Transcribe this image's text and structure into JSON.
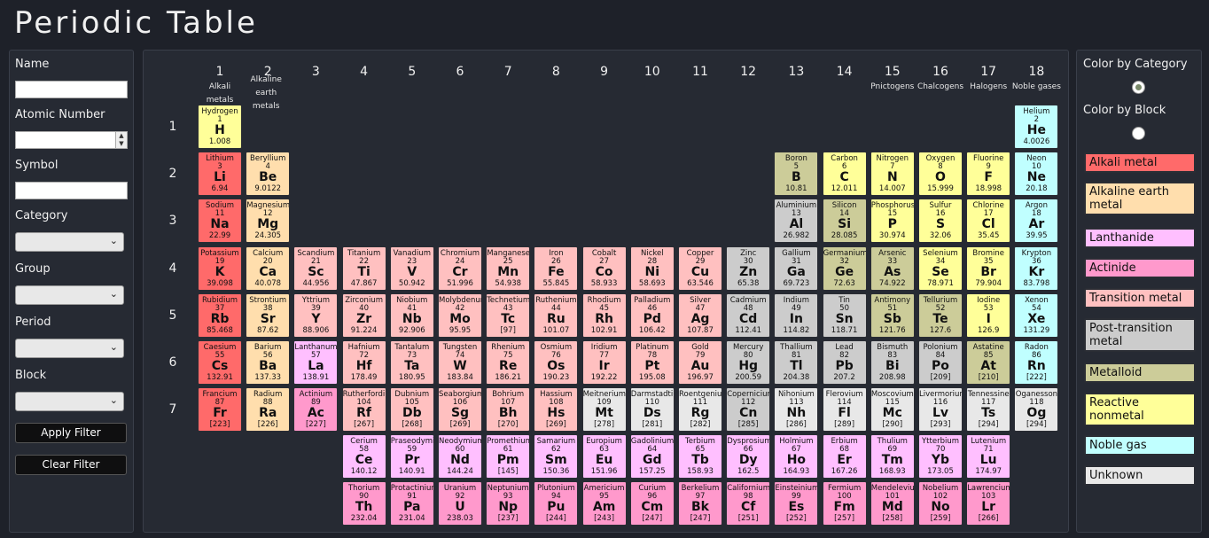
{
  "app": {
    "title": "Periodic Table"
  },
  "filters": {
    "name_label": "Name",
    "name_value": "",
    "atomic_number_label": "Atomic Number",
    "atomic_number_value": "",
    "symbol_label": "Symbol",
    "symbol_value": "",
    "category_label": "Category",
    "category_value": "",
    "group_label": "Group",
    "group_value": "",
    "period_label": "Period",
    "period_value": "",
    "block_label": "Block",
    "block_value": "",
    "apply_label": "Apply Filter",
    "clear_label": "Clear Filter"
  },
  "legend": {
    "by_category_label": "Color by Category",
    "by_block_label": "Color by Block",
    "selected": "category",
    "items": [
      {
        "label": "Alkali metal",
        "key": "alkali",
        "color": "#ff6a6a"
      },
      {
        "label": "Alkaline earth metal",
        "key": "alkaline",
        "color": "#ffdead"
      },
      {
        "label": "Lanthanide",
        "key": "lanthanide",
        "color": "#ffbfff"
      },
      {
        "label": "Actinide",
        "key": "actinide",
        "color": "#ff99cc"
      },
      {
        "label": "Transition metal",
        "key": "transition",
        "color": "#ffc0c0"
      },
      {
        "label": "Post-transition metal",
        "key": "post",
        "color": "#cccccc"
      },
      {
        "label": "Metalloid",
        "key": "metalloid",
        "color": "#cccc99"
      },
      {
        "label": "Reactive nonmetal",
        "key": "nonmetal",
        "color": "#ffff99"
      },
      {
        "label": "Noble gas",
        "key": "noble",
        "color": "#c0ffff"
      },
      {
        "label": "Unknown",
        "key": "unknown",
        "color": "#e8e8e8"
      }
    ]
  },
  "groups": [
    {
      "num": "1",
      "label": "Alkali metals"
    },
    {
      "num": "2",
      "label": "Alkaline earth metals"
    },
    {
      "num": "3",
      "label": ""
    },
    {
      "num": "4",
      "label": ""
    },
    {
      "num": "5",
      "label": ""
    },
    {
      "num": "6",
      "label": ""
    },
    {
      "num": "7",
      "label": ""
    },
    {
      "num": "8",
      "label": ""
    },
    {
      "num": "9",
      "label": ""
    },
    {
      "num": "10",
      "label": ""
    },
    {
      "num": "11",
      "label": ""
    },
    {
      "num": "12",
      "label": ""
    },
    {
      "num": "13",
      "label": ""
    },
    {
      "num": "14",
      "label": ""
    },
    {
      "num": "15",
      "label": "Pnictogens"
    },
    {
      "num": "16",
      "label": "Chalcogens"
    },
    {
      "num": "17",
      "label": "Halogens"
    },
    {
      "num": "18",
      "label": "Noble gases"
    }
  ],
  "periods": [
    "1",
    "2",
    "3",
    "4",
    "5",
    "6",
    "7"
  ],
  "elements": [
    {
      "n": "Hydrogen",
      "z": "1",
      "s": "H",
      "w": "1.008",
      "c": "nonmetal",
      "g": 1,
      "p": 1
    },
    {
      "n": "Helium",
      "z": "2",
      "s": "He",
      "w": "4.0026",
      "c": "noble",
      "g": 18,
      "p": 1
    },
    {
      "n": "Lithium",
      "z": "3",
      "s": "Li",
      "w": "6.94",
      "c": "alkali",
      "g": 1,
      "p": 2
    },
    {
      "n": "Beryllium",
      "z": "4",
      "s": "Be",
      "w": "9.0122",
      "c": "alkaline",
      "g": 2,
      "p": 2
    },
    {
      "n": "Boron",
      "z": "5",
      "s": "B",
      "w": "10.81",
      "c": "metalloid",
      "g": 13,
      "p": 2
    },
    {
      "n": "Carbon",
      "z": "6",
      "s": "C",
      "w": "12.011",
      "c": "nonmetal",
      "g": 14,
      "p": 2
    },
    {
      "n": "Nitrogen",
      "z": "7",
      "s": "N",
      "w": "14.007",
      "c": "nonmetal",
      "g": 15,
      "p": 2
    },
    {
      "n": "Oxygen",
      "z": "8",
      "s": "O",
      "w": "15.999",
      "c": "nonmetal",
      "g": 16,
      "p": 2
    },
    {
      "n": "Fluorine",
      "z": "9",
      "s": "F",
      "w": "18.998",
      "c": "nonmetal",
      "g": 17,
      "p": 2
    },
    {
      "n": "Neon",
      "z": "10",
      "s": "Ne",
      "w": "20.18",
      "c": "noble",
      "g": 18,
      "p": 2
    },
    {
      "n": "Sodium",
      "z": "11",
      "s": "Na",
      "w": "22.99",
      "c": "alkali",
      "g": 1,
      "p": 3
    },
    {
      "n": "Magnesium",
      "z": "12",
      "s": "Mg",
      "w": "24.305",
      "c": "alkaline",
      "g": 2,
      "p": 3
    },
    {
      "n": "Aluminium",
      "z": "13",
      "s": "Al",
      "w": "26.982",
      "c": "post",
      "g": 13,
      "p": 3
    },
    {
      "n": "Silicon",
      "z": "14",
      "s": "Si",
      "w": "28.085",
      "c": "metalloid",
      "g": 14,
      "p": 3
    },
    {
      "n": "Phosphorus",
      "z": "15",
      "s": "P",
      "w": "30.974",
      "c": "nonmetal",
      "g": 15,
      "p": 3
    },
    {
      "n": "Sulfur",
      "z": "16",
      "s": "S",
      "w": "32.06",
      "c": "nonmetal",
      "g": 16,
      "p": 3
    },
    {
      "n": "Chlorine",
      "z": "17",
      "s": "Cl",
      "w": "35.45",
      "c": "nonmetal",
      "g": 17,
      "p": 3
    },
    {
      "n": "Argon",
      "z": "18",
      "s": "Ar",
      "w": "39.95",
      "c": "noble",
      "g": 18,
      "p": 3
    },
    {
      "n": "Potassium",
      "z": "19",
      "s": "K",
      "w": "39.098",
      "c": "alkali",
      "g": 1,
      "p": 4
    },
    {
      "n": "Calcium",
      "z": "20",
      "s": "Ca",
      "w": "40.078",
      "c": "alkaline",
      "g": 2,
      "p": 4
    },
    {
      "n": "Scandium",
      "z": "21",
      "s": "Sc",
      "w": "44.956",
      "c": "transition",
      "g": 3,
      "p": 4
    },
    {
      "n": "Titanium",
      "z": "22",
      "s": "Ti",
      "w": "47.867",
      "c": "transition",
      "g": 4,
      "p": 4
    },
    {
      "n": "Vanadium",
      "z": "23",
      "s": "V",
      "w": "50.942",
      "c": "transition",
      "g": 5,
      "p": 4
    },
    {
      "n": "Chromium",
      "z": "24",
      "s": "Cr",
      "w": "51.996",
      "c": "transition",
      "g": 6,
      "p": 4
    },
    {
      "n": "Manganese",
      "z": "25",
      "s": "Mn",
      "w": "54.938",
      "c": "transition",
      "g": 7,
      "p": 4
    },
    {
      "n": "Iron",
      "z": "26",
      "s": "Fe",
      "w": "55.845",
      "c": "transition",
      "g": 8,
      "p": 4
    },
    {
      "n": "Cobalt",
      "z": "27",
      "s": "Co",
      "w": "58.933",
      "c": "transition",
      "g": 9,
      "p": 4
    },
    {
      "n": "Nickel",
      "z": "28",
      "s": "Ni",
      "w": "58.693",
      "c": "transition",
      "g": 10,
      "p": 4
    },
    {
      "n": "Copper",
      "z": "29",
      "s": "Cu",
      "w": "63.546",
      "c": "transition",
      "g": 11,
      "p": 4
    },
    {
      "n": "Zinc",
      "z": "30",
      "s": "Zn",
      "w": "65.38",
      "c": "post",
      "g": 12,
      "p": 4
    },
    {
      "n": "Gallium",
      "z": "31",
      "s": "Ga",
      "w": "69.723",
      "c": "post",
      "g": 13,
      "p": 4
    },
    {
      "n": "Germanium",
      "z": "32",
      "s": "Ge",
      "w": "72.63",
      "c": "metalloid",
      "g": 14,
      "p": 4
    },
    {
      "n": "Arsenic",
      "z": "33",
      "s": "As",
      "w": "74.922",
      "c": "metalloid",
      "g": 15,
      "p": 4
    },
    {
      "n": "Selenium",
      "z": "34",
      "s": "Se",
      "w": "78.971",
      "c": "nonmetal",
      "g": 16,
      "p": 4
    },
    {
      "n": "Bromine",
      "z": "35",
      "s": "Br",
      "w": "79.904",
      "c": "nonmetal",
      "g": 17,
      "p": 4
    },
    {
      "n": "Krypton",
      "z": "36",
      "s": "Kr",
      "w": "83.798",
      "c": "noble",
      "g": 18,
      "p": 4
    },
    {
      "n": "Rubidium",
      "z": "37",
      "s": "Rb",
      "w": "85.468",
      "c": "alkali",
      "g": 1,
      "p": 5
    },
    {
      "n": "Strontium",
      "z": "38",
      "s": "Sr",
      "w": "87.62",
      "c": "alkaline",
      "g": 2,
      "p": 5
    },
    {
      "n": "Yttrium",
      "z": "39",
      "s": "Y",
      "w": "88.906",
      "c": "transition",
      "g": 3,
      "p": 5
    },
    {
      "n": "Zirconium",
      "z": "40",
      "s": "Zr",
      "w": "91.224",
      "c": "transition",
      "g": 4,
      "p": 5
    },
    {
      "n": "Niobium",
      "z": "41",
      "s": "Nb",
      "w": "92.906",
      "c": "transition",
      "g": 5,
      "p": 5
    },
    {
      "n": "Molybdenum",
      "z": "42",
      "s": "Mo",
      "w": "95.95",
      "c": "transition",
      "g": 6,
      "p": 5
    },
    {
      "n": "Technetium",
      "z": "43",
      "s": "Tc",
      "w": "[97]",
      "c": "transition",
      "g": 7,
      "p": 5
    },
    {
      "n": "Ruthenium",
      "z": "44",
      "s": "Ru",
      "w": "101.07",
      "c": "transition",
      "g": 8,
      "p": 5
    },
    {
      "n": "Rhodium",
      "z": "45",
      "s": "Rh",
      "w": "102.91",
      "c": "transition",
      "g": 9,
      "p": 5
    },
    {
      "n": "Palladium",
      "z": "46",
      "s": "Pd",
      "w": "106.42",
      "c": "transition",
      "g": 10,
      "p": 5
    },
    {
      "n": "Silver",
      "z": "47",
      "s": "Ag",
      "w": "107.87",
      "c": "transition",
      "g": 11,
      "p": 5
    },
    {
      "n": "Cadmium",
      "z": "48",
      "s": "Cd",
      "w": "112.41",
      "c": "post",
      "g": 12,
      "p": 5
    },
    {
      "n": "Indium",
      "z": "49",
      "s": "In",
      "w": "114.82",
      "c": "post",
      "g": 13,
      "p": 5
    },
    {
      "n": "Tin",
      "z": "50",
      "s": "Sn",
      "w": "118.71",
      "c": "post",
      "g": 14,
      "p": 5
    },
    {
      "n": "Antimony",
      "z": "51",
      "s": "Sb",
      "w": "121.76",
      "c": "metalloid",
      "g": 15,
      "p": 5
    },
    {
      "n": "Tellurium",
      "z": "52",
      "s": "Te",
      "w": "127.6",
      "c": "metalloid",
      "g": 16,
      "p": 5
    },
    {
      "n": "Iodine",
      "z": "53",
      "s": "I",
      "w": "126.9",
      "c": "nonmetal",
      "g": 17,
      "p": 5
    },
    {
      "n": "Xenon",
      "z": "54",
      "s": "Xe",
      "w": "131.29",
      "c": "noble",
      "g": 18,
      "p": 5
    },
    {
      "n": "Caesium",
      "z": "55",
      "s": "Cs",
      "w": "132.91",
      "c": "alkali",
      "g": 1,
      "p": 6
    },
    {
      "n": "Barium",
      "z": "56",
      "s": "Ba",
      "w": "137.33",
      "c": "alkaline",
      "g": 2,
      "p": 6
    },
    {
      "n": "Lanthanum",
      "z": "57",
      "s": "La",
      "w": "138.91",
      "c": "lanthanide",
      "g": 3,
      "p": 6
    },
    {
      "n": "Hafnium",
      "z": "72",
      "s": "Hf",
      "w": "178.49",
      "c": "transition",
      "g": 4,
      "p": 6
    },
    {
      "n": "Tantalum",
      "z": "73",
      "s": "Ta",
      "w": "180.95",
      "c": "transition",
      "g": 5,
      "p": 6
    },
    {
      "n": "Tungsten",
      "z": "74",
      "s": "W",
      "w": "183.84",
      "c": "transition",
      "g": 6,
      "p": 6
    },
    {
      "n": "Rhenium",
      "z": "75",
      "s": "Re",
      "w": "186.21",
      "c": "transition",
      "g": 7,
      "p": 6
    },
    {
      "n": "Osmium",
      "z": "76",
      "s": "Os",
      "w": "190.23",
      "c": "transition",
      "g": 8,
      "p": 6
    },
    {
      "n": "Iridium",
      "z": "77",
      "s": "Ir",
      "w": "192.22",
      "c": "transition",
      "g": 9,
      "p": 6
    },
    {
      "n": "Platinum",
      "z": "78",
      "s": "Pt",
      "w": "195.08",
      "c": "transition",
      "g": 10,
      "p": 6
    },
    {
      "n": "Gold",
      "z": "79",
      "s": "Au",
      "w": "196.97",
      "c": "transition",
      "g": 11,
      "p": 6
    },
    {
      "n": "Mercury",
      "z": "80",
      "s": "Hg",
      "w": "200.59",
      "c": "post",
      "g": 12,
      "p": 6
    },
    {
      "n": "Thallium",
      "z": "81",
      "s": "Tl",
      "w": "204.38",
      "c": "post",
      "g": 13,
      "p": 6
    },
    {
      "n": "Lead",
      "z": "82",
      "s": "Pb",
      "w": "207.2",
      "c": "post",
      "g": 14,
      "p": 6
    },
    {
      "n": "Bismuth",
      "z": "83",
      "s": "Bi",
      "w": "208.98",
      "c": "post",
      "g": 15,
      "p": 6
    },
    {
      "n": "Polonium",
      "z": "84",
      "s": "Po",
      "w": "[209]",
      "c": "post",
      "g": 16,
      "p": 6
    },
    {
      "n": "Astatine",
      "z": "85",
      "s": "At",
      "w": "[210]",
      "c": "metalloid",
      "g": 17,
      "p": 6
    },
    {
      "n": "Radon",
      "z": "86",
      "s": "Rn",
      "w": "[222]",
      "c": "noble",
      "g": 18,
      "p": 6
    },
    {
      "n": "Francium",
      "z": "87",
      "s": "Fr",
      "w": "[223]",
      "c": "alkali",
      "g": 1,
      "p": 7
    },
    {
      "n": "Radium",
      "z": "88",
      "s": "Ra",
      "w": "[226]",
      "c": "alkaline",
      "g": 2,
      "p": 7
    },
    {
      "n": "Actinium",
      "z": "89",
      "s": "Ac",
      "w": "[227]",
      "c": "actinide",
      "g": 3,
      "p": 7
    },
    {
      "n": "Rutherfordium",
      "z": "104",
      "s": "Rf",
      "w": "[267]",
      "c": "transition",
      "g": 4,
      "p": 7
    },
    {
      "n": "Dubnium",
      "z": "105",
      "s": "Db",
      "w": "[268]",
      "c": "transition",
      "g": 5,
      "p": 7
    },
    {
      "n": "Seaborgium",
      "z": "106",
      "s": "Sg",
      "w": "[269]",
      "c": "transition",
      "g": 6,
      "p": 7
    },
    {
      "n": "Bohrium",
      "z": "107",
      "s": "Bh",
      "w": "[270]",
      "c": "transition",
      "g": 7,
      "p": 7
    },
    {
      "n": "Hassium",
      "z": "108",
      "s": "Hs",
      "w": "[269]",
      "c": "transition",
      "g": 8,
      "p": 7
    },
    {
      "n": "Meitnerium",
      "z": "109",
      "s": "Mt",
      "w": "[278]",
      "c": "unknown",
      "g": 9,
      "p": 7
    },
    {
      "n": "Darmstadtium",
      "z": "110",
      "s": "Ds",
      "w": "[281]",
      "c": "unknown",
      "g": 10,
      "p": 7
    },
    {
      "n": "Roentgenium",
      "z": "111",
      "s": "Rg",
      "w": "[282]",
      "c": "unknown",
      "g": 11,
      "p": 7
    },
    {
      "n": "Copernicium",
      "z": "112",
      "s": "Cn",
      "w": "[285]",
      "c": "post",
      "g": 12,
      "p": 7
    },
    {
      "n": "Nihonium",
      "z": "113",
      "s": "Nh",
      "w": "[286]",
      "c": "unknown",
      "g": 13,
      "p": 7
    },
    {
      "n": "Flerovium",
      "z": "114",
      "s": "Fl",
      "w": "[289]",
      "c": "unknown",
      "g": 14,
      "p": 7
    },
    {
      "n": "Moscovium",
      "z": "115",
      "s": "Mc",
      "w": "[290]",
      "c": "unknown",
      "g": 15,
      "p": 7
    },
    {
      "n": "Livermorium",
      "z": "116",
      "s": "Lv",
      "w": "[293]",
      "c": "unknown",
      "g": 16,
      "p": 7
    },
    {
      "n": "Tennessine",
      "z": "117",
      "s": "Ts",
      "w": "[294]",
      "c": "unknown",
      "g": 17,
      "p": 7
    },
    {
      "n": "Oganesson",
      "z": "118",
      "s": "Og",
      "w": "[294]",
      "c": "unknown",
      "g": 18,
      "p": 7
    },
    {
      "n": "Cerium",
      "z": "58",
      "s": "Ce",
      "w": "140.12",
      "c": "lanthanide",
      "g": 4,
      "p": 8
    },
    {
      "n": "Praseodymium",
      "z": "59",
      "s": "Pr",
      "w": "140.91",
      "c": "lanthanide",
      "g": 5,
      "p": 8
    },
    {
      "n": "Neodymium",
      "z": "60",
      "s": "Nd",
      "w": "144.24",
      "c": "lanthanide",
      "g": 6,
      "p": 8
    },
    {
      "n": "Promethium",
      "z": "61",
      "s": "Pm",
      "w": "[145]",
      "c": "lanthanide",
      "g": 7,
      "p": 8
    },
    {
      "n": "Samarium",
      "z": "62",
      "s": "Sm",
      "w": "150.36",
      "c": "lanthanide",
      "g": 8,
      "p": 8
    },
    {
      "n": "Europium",
      "z": "63",
      "s": "Eu",
      "w": "151.96",
      "c": "lanthanide",
      "g": 9,
      "p": 8
    },
    {
      "n": "Gadolinium",
      "z": "64",
      "s": "Gd",
      "w": "157.25",
      "c": "lanthanide",
      "g": 10,
      "p": 8
    },
    {
      "n": "Terbium",
      "z": "65",
      "s": "Tb",
      "w": "158.93",
      "c": "lanthanide",
      "g": 11,
      "p": 8
    },
    {
      "n": "Dysprosium",
      "z": "66",
      "s": "Dy",
      "w": "162.5",
      "c": "lanthanide",
      "g": 12,
      "p": 8
    },
    {
      "n": "Holmium",
      "z": "67",
      "s": "Ho",
      "w": "164.93",
      "c": "lanthanide",
      "g": 13,
      "p": 8
    },
    {
      "n": "Erbium",
      "z": "68",
      "s": "Er",
      "w": "167.26",
      "c": "lanthanide",
      "g": 14,
      "p": 8
    },
    {
      "n": "Thulium",
      "z": "69",
      "s": "Tm",
      "w": "168.93",
      "c": "lanthanide",
      "g": 15,
      "p": 8
    },
    {
      "n": "Ytterbium",
      "z": "70",
      "s": "Yb",
      "w": "173.05",
      "c": "lanthanide",
      "g": 16,
      "p": 8
    },
    {
      "n": "Lutenium",
      "z": "71",
      "s": "Lu",
      "w": "174.97",
      "c": "lanthanide",
      "g": 17,
      "p": 8
    },
    {
      "n": "Thorium",
      "z": "90",
      "s": "Th",
      "w": "232.04",
      "c": "actinide",
      "g": 4,
      "p": 9
    },
    {
      "n": "Protactinium",
      "z": "91",
      "s": "Pa",
      "w": "231.04",
      "c": "actinide",
      "g": 5,
      "p": 9
    },
    {
      "n": "Uranium",
      "z": "92",
      "s": "U",
      "w": "238.03",
      "c": "actinide",
      "g": 6,
      "p": 9
    },
    {
      "n": "Neptunium",
      "z": "93",
      "s": "Np",
      "w": "[237]",
      "c": "actinide",
      "g": 7,
      "p": 9
    },
    {
      "n": "Plutonium",
      "z": "94",
      "s": "Pu",
      "w": "[244]",
      "c": "actinide",
      "g": 8,
      "p": 9
    },
    {
      "n": "Americium",
      "z": "95",
      "s": "Am",
      "w": "[243]",
      "c": "actinide",
      "g": 9,
      "p": 9
    },
    {
      "n": "Curium",
      "z": "96",
      "s": "Cm",
      "w": "[247]",
      "c": "actinide",
      "g": 10,
      "p": 9
    },
    {
      "n": "Berkelium",
      "z": "97",
      "s": "Bk",
      "w": "[247]",
      "c": "actinide",
      "g": 11,
      "p": 9
    },
    {
      "n": "Californium",
      "z": "98",
      "s": "Cf",
      "w": "[251]",
      "c": "actinide",
      "g": 12,
      "p": 9
    },
    {
      "n": "Einsteinium",
      "z": "99",
      "s": "Es",
      "w": "[252]",
      "c": "actinide",
      "g": 13,
      "p": 9
    },
    {
      "n": "Fermium",
      "z": "100",
      "s": "Fm",
      "w": "[257]",
      "c": "actinide",
      "g": 14,
      "p": 9
    },
    {
      "n": "Mendelevium",
      "z": "101",
      "s": "Md",
      "w": "[258]",
      "c": "actinide",
      "g": 15,
      "p": 9
    },
    {
      "n": "Nobelium",
      "z": "102",
      "s": "No",
      "w": "[259]",
      "c": "actinide",
      "g": 16,
      "p": 9
    },
    {
      "n": "Lawrencium",
      "z": "103",
      "s": "Lr",
      "w": "[266]",
      "c": "actinide",
      "g": 17,
      "p": 9
    }
  ]
}
